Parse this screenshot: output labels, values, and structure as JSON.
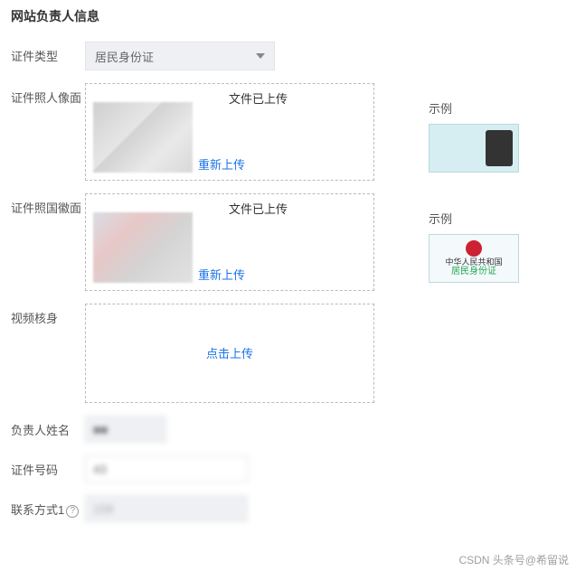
{
  "section_title": "网站负责人信息",
  "labels": {
    "id_type": "证件类型",
    "photo_front": "证件照人像面",
    "photo_back": "证件照国徽面",
    "video_verify": "视频核身",
    "name": "负责人姓名",
    "id_number": "证件号码",
    "contact1": "联系方式1"
  },
  "id_type": {
    "selected": "居民身份证"
  },
  "upload": {
    "status": "文件已上传",
    "reupload": "重新上传",
    "click_upload": "点击上传"
  },
  "example_label": "示例",
  "example_back": {
    "line1": "中华人民共和国",
    "line2": "居民身份证"
  },
  "fields": {
    "name": "■■",
    "id_number": "43",
    "contact1": "158"
  },
  "watermark": "CSDN 头条号@希留说"
}
